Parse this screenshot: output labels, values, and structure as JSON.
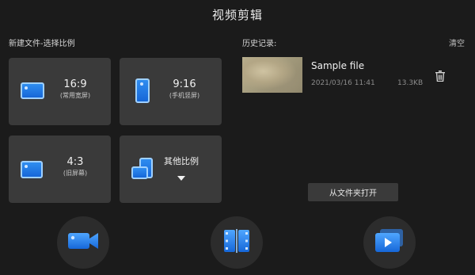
{
  "header": {
    "title": "视频剪辑"
  },
  "new_file": {
    "label": "新建文件-选择比例",
    "ratios": [
      {
        "ratio": "16:9",
        "desc": "(常用宽屏)",
        "icon": "widescreen-icon"
      },
      {
        "ratio": "9:16",
        "desc": "(手机竖屏)",
        "icon": "portrait-icon"
      },
      {
        "ratio": "4:3",
        "desc": "(旧屏幕)",
        "icon": "classic-screen-icon"
      },
      {
        "ratio": "其他比例",
        "desc": "",
        "icon": "other-ratio-icon"
      }
    ]
  },
  "history": {
    "label": "历史记录:",
    "clear_label": "清空",
    "items": [
      {
        "name": "Sample file",
        "date": "2021/03/16 11:41",
        "size": "13.3KB"
      }
    ],
    "open_folder_label": "从文件夹打开"
  },
  "toolbar": {
    "buttons": [
      {
        "icon": "video-camera-icon"
      },
      {
        "icon": "film-strip-icon"
      },
      {
        "icon": "play-video-icon"
      }
    ]
  },
  "colors": {
    "accent": "#1a74e0",
    "card_bg": "#3a3a3a",
    "background": "#1b1b1b"
  }
}
